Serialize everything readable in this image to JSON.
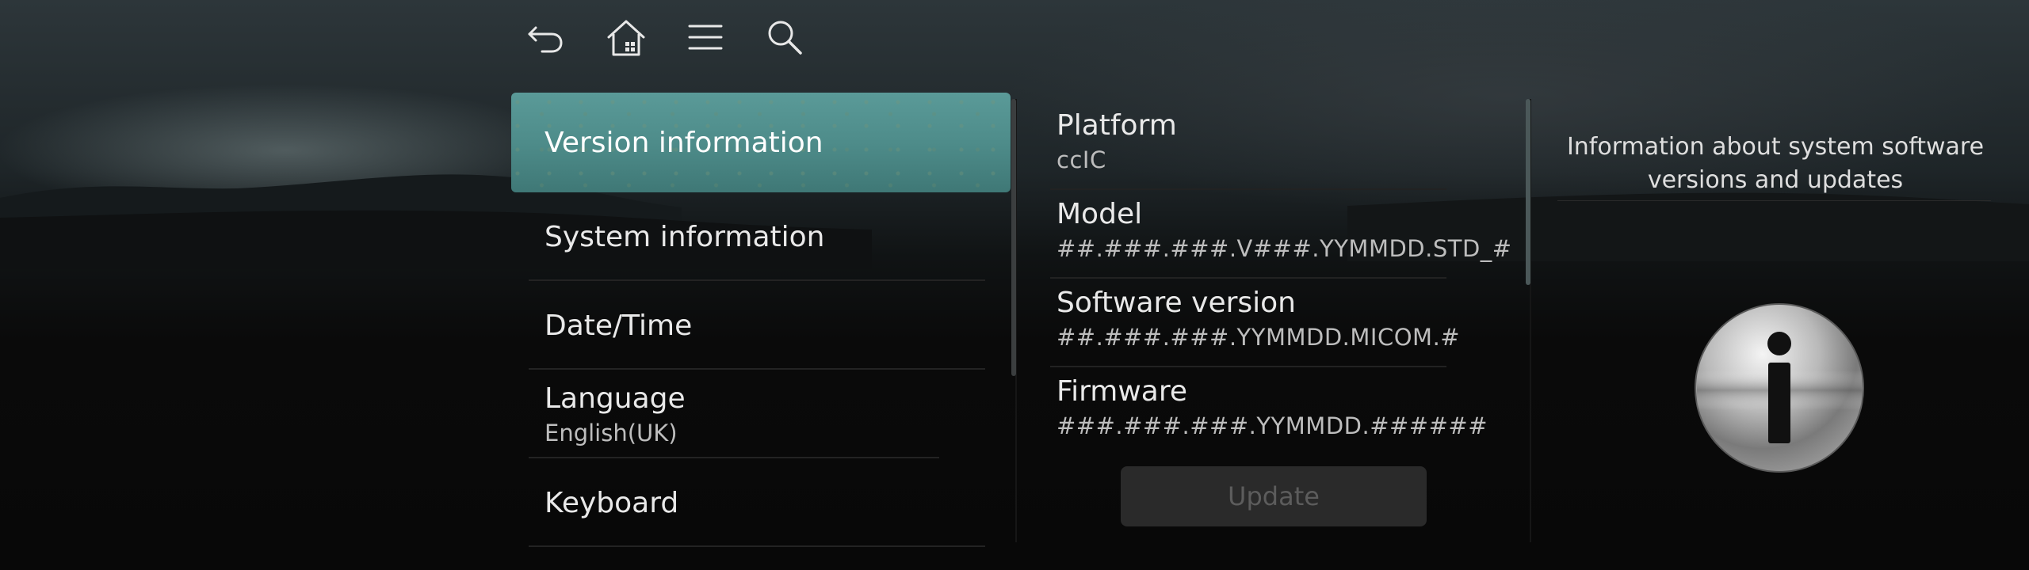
{
  "nav": {
    "icons": [
      "back-icon",
      "home-icon",
      "menu-icon",
      "search-icon"
    ]
  },
  "menu": {
    "items": [
      {
        "label": "Version information",
        "sub": "",
        "selected": true
      },
      {
        "label": "System information",
        "sub": "",
        "selected": false
      },
      {
        "label": "Date/Time",
        "sub": "",
        "selected": false
      },
      {
        "label": "Language",
        "sub": "English(UK)",
        "selected": false
      },
      {
        "label": "Keyboard",
        "sub": "",
        "selected": false
      }
    ]
  },
  "info": {
    "rows": [
      {
        "label": "Platform",
        "value": "ccIC"
      },
      {
        "label": "Model",
        "value": "##.###.###.V###.YYMMDD.STD_#"
      },
      {
        "label": "Software version",
        "value": "##.###.###.YYMMDD.MICOM.#"
      },
      {
        "label": "Firmware",
        "value": "###.###.###.YYMMDD.######"
      }
    ],
    "update_label": "Update"
  },
  "help": {
    "description": "Information about system software versions and updates",
    "icon": "info-icon"
  },
  "colors": {
    "accent": "#4e8c8a",
    "background": "#0b0b0b",
    "text": "#e6e6e6",
    "disabled_button": "#2a2a2a"
  }
}
